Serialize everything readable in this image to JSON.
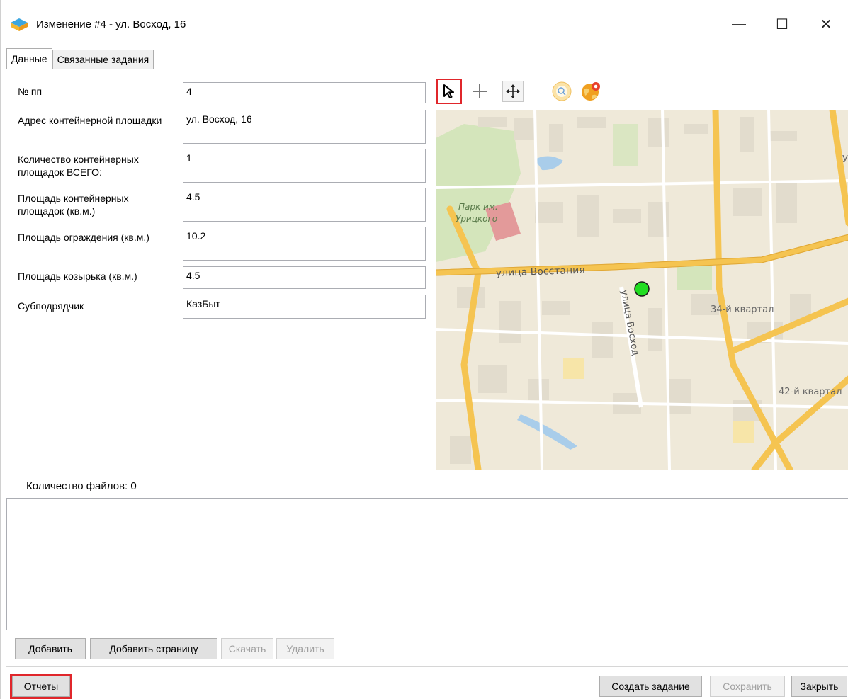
{
  "window": {
    "title": "Изменение #4 - ул. Восход, 16",
    "controls": {
      "minimize": "—",
      "maximize": "☐",
      "close": "✕"
    }
  },
  "tabs": [
    {
      "label": "Данные",
      "active": true
    },
    {
      "label": "Связанные задания",
      "active": false
    }
  ],
  "form": {
    "fields": [
      {
        "label": "№ пп",
        "value": "4"
      },
      {
        "label": "Адрес контейнерной площадки",
        "value": "ул. Восход, 16"
      },
      {
        "label": "Количество контейнерных площадок ВСЕГО:",
        "value": "1"
      },
      {
        "label": "Площадь контейнерных площадок (кв.м.)",
        "value": "4.5"
      },
      {
        "label": "Площадь ограждения (кв.м.)",
        "value": "10.2"
      },
      {
        "label": "Площадь козырька (кв.м.)",
        "value": "4.5"
      },
      {
        "label": "Субподрядчик",
        "value": "КазБыт"
      }
    ]
  },
  "map_toolbar": {
    "tools": [
      "select-arrow-icon",
      "crosshair-icon",
      "pan-move-icon",
      "zoom-extent-icon",
      "globe-location-icon"
    ],
    "selected": "select-arrow-icon"
  },
  "map": {
    "labels": {
      "park": "Парк им. Урицкого",
      "park_line1": "Парк им.",
      "park_line2": "Урицкого",
      "street_main": "улица Восстания",
      "street_voshod": "улица Восход",
      "quarter_34": "34-й квартал",
      "quarter_42": "42-й квартал",
      "edge_letter": "У"
    },
    "marker_color": "#22dd22"
  },
  "files": {
    "label": "Количество файлов: 0",
    "buttons": {
      "add": "Добавить",
      "add_page": "Добавить страницу",
      "download": "Скачать",
      "delete": "Удалить"
    }
  },
  "footer": {
    "reports": "Отчеты",
    "create_task": "Создать задание",
    "save": "Сохранить",
    "close": "Закрыть"
  },
  "colors": {
    "highlight": "#e0262b",
    "map_road": "#f5c451",
    "map_base": "#efe9d9",
    "map_park": "#cfe3b6"
  }
}
